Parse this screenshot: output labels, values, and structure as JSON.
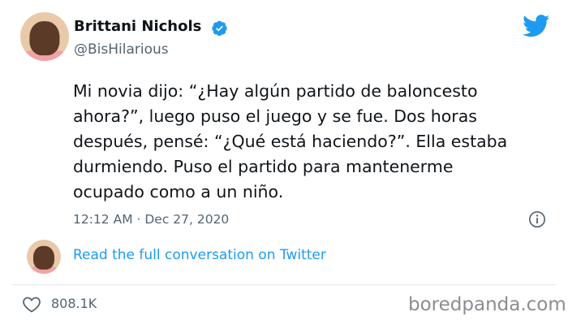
{
  "author": {
    "display_name": "Brittani Nichols",
    "handle": "@BisHilarious",
    "verified": true
  },
  "tweet": {
    "text": "Mi novia dijo: “¿Hay algún partido de baloncesto\nahora?”, luego puso el juego y se fue. Dos horas\ndespués, pensé: “¿Qué está haciendo?”. Ella estaba\ndurmiendo. Puso el partido para mantenerme\nocupado como a un niño.",
    "timestamp": "12:12 AM · Dec 27, 2020",
    "likes": "808.1K"
  },
  "conversation_link": "Read the full conversation on Twitter",
  "watermark": "boredpanda.com",
  "icons": {
    "verified": "verified-badge-icon",
    "brand": "twitter-bird-icon",
    "info": "info-icon",
    "like": "heart-icon"
  },
  "colors": {
    "twitter_blue": "#1d9bf0",
    "text_primary": "#0f1419",
    "text_secondary": "#536471",
    "watermark": "#8a8d91"
  }
}
